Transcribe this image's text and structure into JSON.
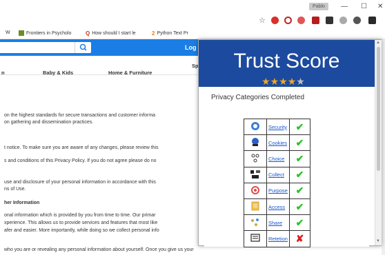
{
  "titlebar": {
    "user": "Pablo",
    "minimize": "—",
    "maximize": "☐",
    "close": "✕"
  },
  "addrbar": {
    "star": "☆"
  },
  "bookmarks": [
    {
      "label": "W"
    },
    {
      "label": "Frontiers in Psycholo"
    },
    {
      "label": "How should I start le"
    },
    {
      "label": "Python Text Pr"
    }
  ],
  "header": {
    "login": "Log"
  },
  "catnav": [
    {
      "label": "n"
    },
    {
      "label": "Baby & Kids"
    },
    {
      "label": "Home & Furniture"
    },
    {
      "label": "Sp"
    }
  ],
  "content": {
    "lines": [
      "on the highest standards for secure transactions and customer informa",
      "on gathering and dissemination practices.",
      "t notice. To make sure you are aware of any changes, please review this",
      "s and conditions of this Privacy Policy. If you do not agree please do no",
      "use and disclosure of your personal information in accordance with this",
      "ns of Use.",
      "her Information",
      "onal information which is provided by you from time to time. Our primar",
      "xperience. This allows us to provide services and features that most like",
      "afer and easier. More importantly, while doing so we collect personal info",
      "who you are or revealing any personal information about yourself. Once you give us your"
    ]
  },
  "popup": {
    "title": "Trust Score",
    "rating": 4,
    "rating_max": 5,
    "section_title": "Privacy Categories Completed",
    "categories": [
      {
        "name": "Security",
        "icon": "shield-icon",
        "status": "ok",
        "mark": "✔"
      },
      {
        "name": "Cookies",
        "icon": "cookie-monster-icon",
        "status": "ok",
        "mark": "✔"
      },
      {
        "name": "Choice",
        "icon": "choice-icon",
        "status": "ok",
        "mark": "✔"
      },
      {
        "name": "Collect",
        "icon": "collect-icon",
        "status": "ok",
        "mark": "✔"
      },
      {
        "name": "Purpose",
        "icon": "target-icon",
        "status": "ok",
        "mark": "✔"
      },
      {
        "name": "Access",
        "icon": "document-icon",
        "status": "ok",
        "mark": "✔"
      },
      {
        "name": "Share",
        "icon": "share-icon",
        "status": "ok",
        "mark": "✔"
      },
      {
        "name": "Retetion",
        "icon": "retention-icon",
        "status": "no",
        "mark": "✘"
      }
    ]
  },
  "colors": {
    "popup_header": "#1c4a9e",
    "site_header": "#1a7ee6",
    "star_on": "#f3a81d",
    "star_off": "#bfbfbf",
    "check": "#2fbf2f",
    "cross": "#d81f1f",
    "link": "#1a55c8"
  }
}
